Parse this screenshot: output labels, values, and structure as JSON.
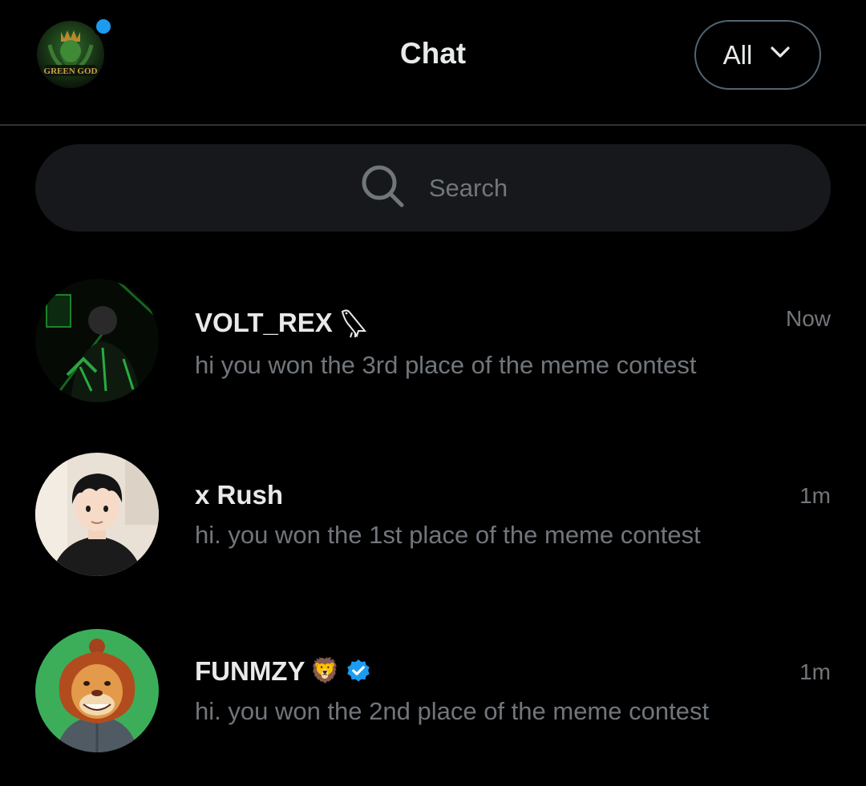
{
  "header": {
    "title": "Chat",
    "profile_logo_text": "GREEN GOD",
    "filter": {
      "label": "All",
      "icon": "chevron-down-icon"
    }
  },
  "search": {
    "placeholder": "Search",
    "icon": "search-icon"
  },
  "chats": [
    {
      "name": "VOLT_REX",
      "name_icon": "bird-icon",
      "message": "hi you won the 3rd place of the meme contest",
      "time": "Now"
    },
    {
      "name": "x Rush",
      "message": "hi. you won the 1st place of the meme contest",
      "time": "1m"
    },
    {
      "name": "FUNMZY",
      "name_emoji": "🦁",
      "verified": true,
      "message": "hi. you won the 2nd place of the meme contest",
      "time": "1m"
    }
  ],
  "colors": {
    "background": "#000000",
    "accent": "#1d9bf0",
    "text_primary": "#e7e9ea",
    "text_secondary": "#71767b",
    "search_bg": "#16181c",
    "divider": "#2f3336"
  }
}
